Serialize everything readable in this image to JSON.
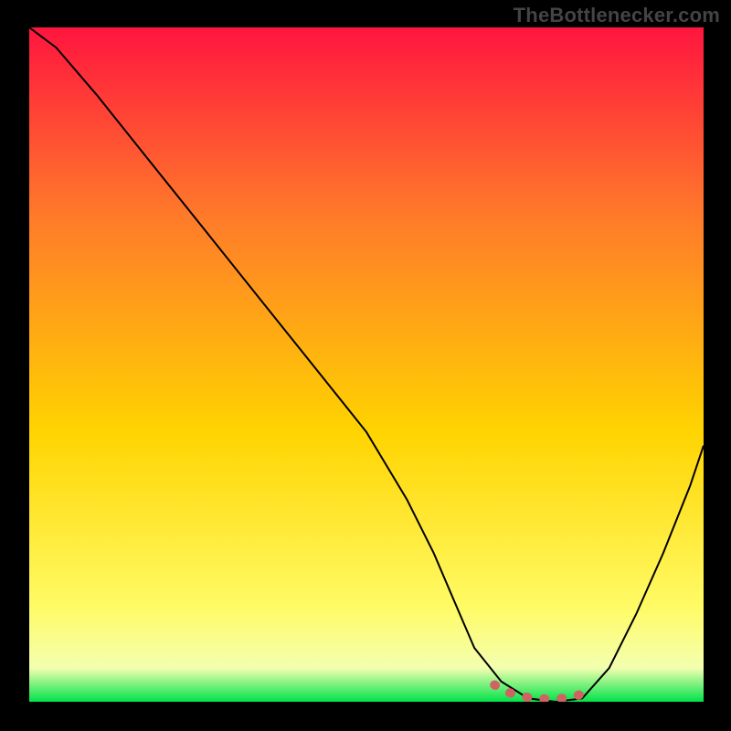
{
  "watermark": "TheBottlenecker.com",
  "colors": {
    "background_black": "#000000",
    "gradient_top": "#ff153f",
    "gradient_mid1": "#ff7a2a",
    "gradient_mid2": "#ffd400",
    "gradient_low": "#fffb66",
    "gradient_pale": "#f3ffb0",
    "gradient_bottom": "#00e24a",
    "curve": "#000000",
    "highlight": "#d16262"
  },
  "chart_data": {
    "type": "line",
    "title": "",
    "xlabel": "",
    "ylabel": "",
    "xlim": [
      0,
      100
    ],
    "ylim": [
      0,
      100
    ],
    "grid": false,
    "series": [
      {
        "name": "bottleneck-curve",
        "x": [
          0,
          4,
          10,
          18,
          26,
          34,
          42,
          50,
          56,
          60,
          63,
          66,
          70,
          74,
          78,
          82,
          86,
          90,
          94,
          98,
          100
        ],
        "y": [
          100,
          97,
          90,
          80,
          70,
          60,
          50,
          40,
          30,
          22,
          15,
          8,
          3,
          0.5,
          0,
          0.5,
          5,
          13,
          22,
          32,
          38
        ]
      }
    ],
    "highlight_segment": {
      "name": "optimal-range",
      "x": [
        69,
        71,
        73,
        75,
        77,
        79,
        81,
        82,
        83
      ],
      "y": [
        2.5,
        1.4,
        0.8,
        0.5,
        0.4,
        0.5,
        0.8,
        1.2,
        2.0
      ]
    }
  }
}
